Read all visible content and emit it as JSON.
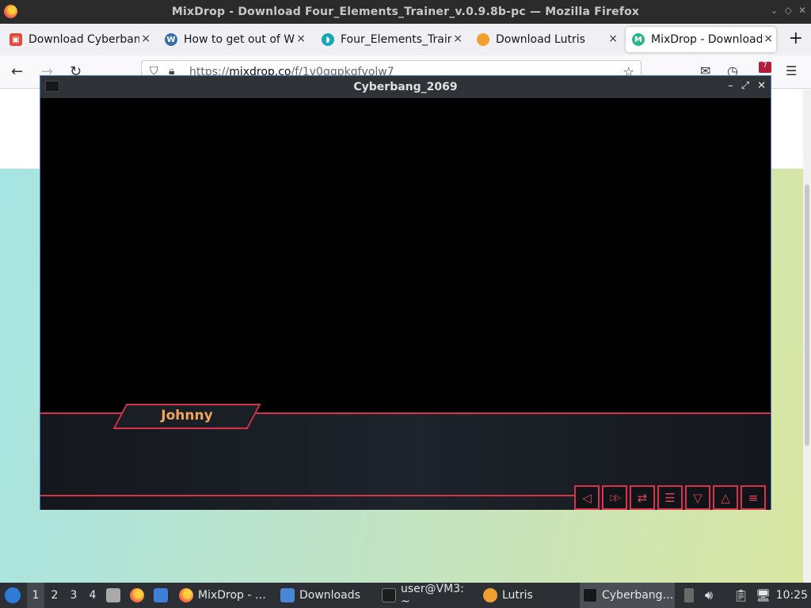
{
  "firefox": {
    "window_title": "MixDrop - Download Four_Elements_Trainer_v.0.9.8b-pc — Mozilla Firefox",
    "tabs": [
      {
        "label": "Download Cyberbang",
        "favicon": "game-icon"
      },
      {
        "label": "How to get out of Wi",
        "favicon": "wordpress-icon"
      },
      {
        "label": "Four_Elements_Traine",
        "favicon": "drive-icon"
      },
      {
        "label": "Download Lutris",
        "favicon": "lutris-icon"
      },
      {
        "label": "MixDrop - Download",
        "favicon": "mixdrop-icon"
      }
    ],
    "close_glyph": "×",
    "new_tab_glyph": "+",
    "url_prefix": "https://",
    "url_domain": "mixdrop.co",
    "url_path": "/f/1v0qqpkqfvolw7",
    "extension_badge": "7"
  },
  "game": {
    "title": "Cyberbang_2069",
    "speaker_name": "Johnny",
    "controls": [
      {
        "name": "back-icon",
        "glyph": "◁"
      },
      {
        "name": "skip-icon",
        "glyph": "▷▷"
      },
      {
        "name": "auto-icon",
        "glyph": "⇄"
      },
      {
        "name": "history-icon",
        "glyph": "☰"
      },
      {
        "name": "save-icon",
        "glyph": "▽"
      },
      {
        "name": "load-icon",
        "glyph": "△"
      },
      {
        "name": "settings-icon",
        "glyph": "≡"
      }
    ]
  },
  "taskbar": {
    "workspaces": [
      "1",
      "2",
      "3",
      "4"
    ],
    "tasks": [
      {
        "label": "MixDrop - …",
        "icon": "firefox-icon"
      },
      {
        "label": "Downloads",
        "icon": "folder-icon"
      },
      {
        "label": "user@VM3: ~",
        "icon": "terminal-icon"
      },
      {
        "label": "Lutris",
        "icon": "lutris-icon"
      },
      {
        "label": "Cyberbang…",
        "icon": "game-icon"
      }
    ],
    "clock": "10:25"
  },
  "colors": {
    "accent_red": "#d8334a",
    "name_orange": "#f2a45c"
  }
}
